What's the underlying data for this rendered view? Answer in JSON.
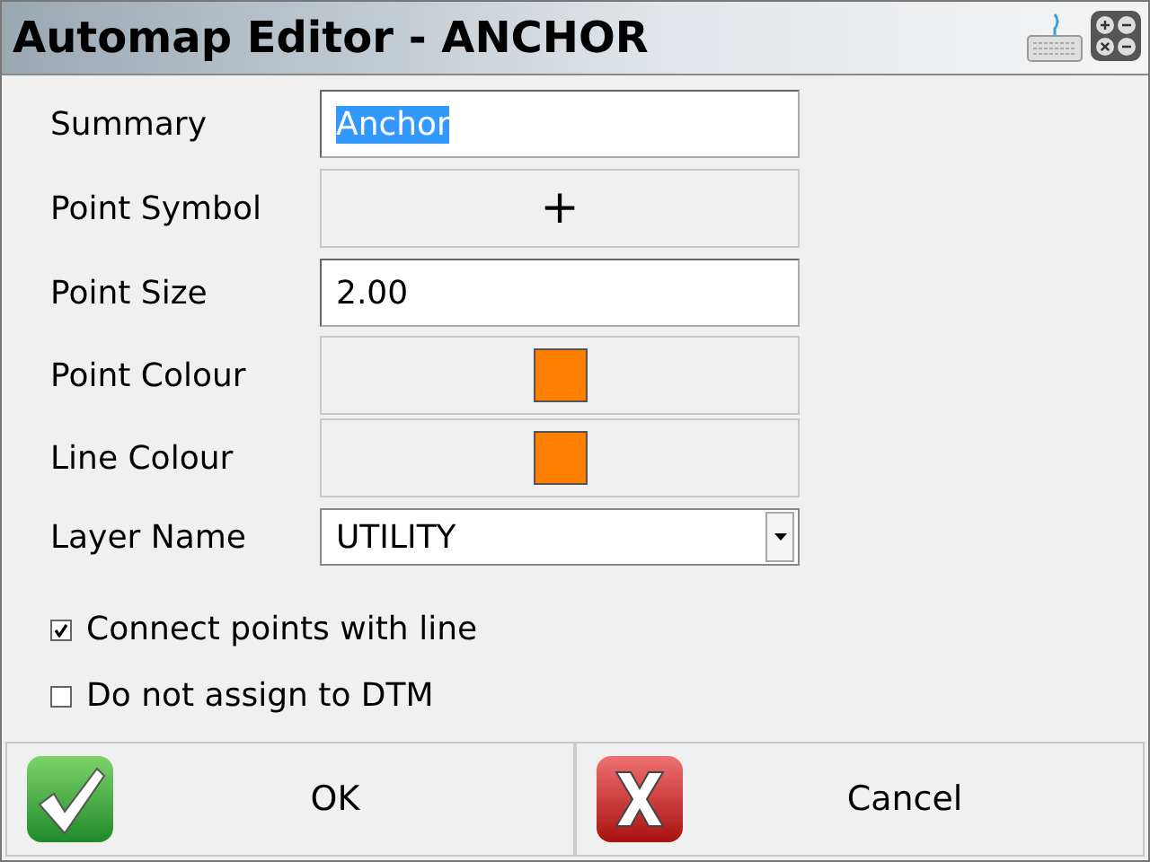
{
  "window": {
    "title": "Automap Editor - ANCHOR"
  },
  "rows": [
    {
      "kind": "field",
      "label": "Summary",
      "value": "Anchor",
      "highlighted": true
    },
    {
      "kind": "symbol",
      "label": "Point Symbol",
      "value": "+"
    },
    {
      "kind": "field",
      "label": "Point Size",
      "value": "2.00",
      "highlighted": false
    },
    {
      "kind": "color",
      "label": "Point Colour",
      "color": "#ff8000"
    },
    {
      "kind": "color",
      "label": "Line Colour",
      "color": "#ff8000"
    },
    {
      "kind": "select",
      "label": "Layer Name",
      "value": "UTILITY"
    }
  ],
  "options": [
    {
      "label": "Connect points with line",
      "checked": true
    },
    {
      "label": "Do not assign to DTM",
      "checked": false
    }
  ],
  "buttons": [
    {
      "kind": "ok",
      "label": "OK"
    },
    {
      "kind": "cancel",
      "label": "Cancel"
    }
  ]
}
